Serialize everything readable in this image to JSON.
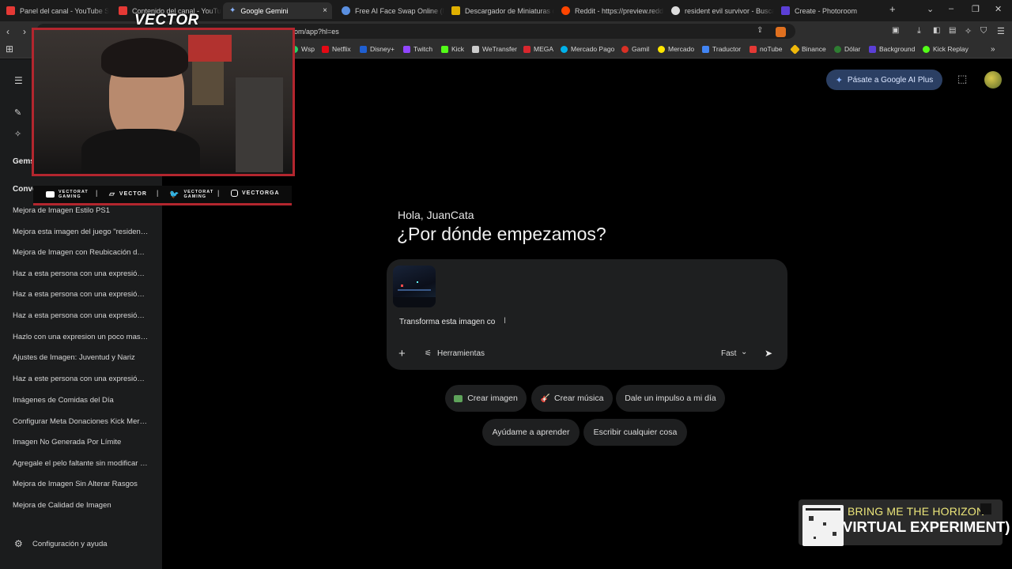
{
  "tabs": [
    {
      "label": "Panel del canal - YouTube Stu",
      "color": "#e53935"
    },
    {
      "label": "Contenido del canal - YouTub",
      "color": "#e53935"
    },
    {
      "label": "Google Gemini",
      "color": "#6fa2ff"
    },
    {
      "label": "Free AI Face Swap Online (No",
      "color": "#5a8fe0"
    },
    {
      "label": "Descargador de Miniaturas de",
      "color": "#e0b000"
    },
    {
      "label": "Reddit - https://preview.redd",
      "color": "#ff4500"
    },
    {
      "label": "resident evil survivor - Buscar",
      "color": "#dddddd"
    },
    {
      "label": "Create - Photoroom",
      "color": "#5b3fd6"
    }
  ],
  "tab_close": "×",
  "new_tab": "+",
  "window_controls": {
    "dropdown": "⌄",
    "minimize": "–",
    "restore": "❐",
    "close": "✕"
  },
  "address": {
    "url": "om/app?hl=es"
  },
  "bookmarks": [
    {
      "label": "Wsp",
      "color": "#25d366"
    },
    {
      "label": "Netflix",
      "color": "#e50914"
    },
    {
      "label": "Disney+",
      "color": "#1f5fd1"
    },
    {
      "label": "Twitch",
      "color": "#9146ff"
    },
    {
      "label": "Kick",
      "color": "#53fc18"
    },
    {
      "label": "WeTransfer",
      "color": "#cccccc"
    },
    {
      "label": "MEGA",
      "color": "#d9272e"
    },
    {
      "label": "Mercado Pago",
      "color": "#00b1ea"
    },
    {
      "label": "Gamil",
      "color": "#d93025"
    },
    {
      "label": "Mercado",
      "color": "#ffe600"
    },
    {
      "label": "Traductor",
      "color": "#4285f4"
    },
    {
      "label": "noTube",
      "color": "#e53935"
    },
    {
      "label": "Binance",
      "color": "#f0b90b"
    },
    {
      "label": "Dólar",
      "color": "#2e7d32"
    },
    {
      "label": "Background",
      "color": "#5b3fd6"
    },
    {
      "label": "Kick Replay",
      "color": "#53fc18"
    }
  ],
  "bookmarks_more": "»",
  "sidebar": {
    "gems_header": "Gems",
    "conversations_header": "Conve",
    "items": [
      "Mejora de Imagen Estilo PS1",
      "Mejora esta imagen del juego \"resident evil survivor\"",
      "Mejora de Imagen con Reubicación de la cámara",
      "Haz a esta persona con una expresión de sorpresa",
      "Haz a esta persona con una expresión de miedo",
      "Haz a esta persona con una expresión de enojo",
      "Hazlo con una expresion un poco mas seria",
      "Ajustes de Imagen: Juventud y Nariz",
      "Haz a este persona con una expresión de alegria",
      "Imágenes de Comidas del Día",
      "Configurar Meta Donaciones Kick Mercado",
      "Imagen No Generada Por Límite",
      "Agregale el pelo faltante sin modificar nada",
      "Mejora de Imagen Sin Alterar Rasgos",
      "Mejora de Calidad de Imagen"
    ],
    "settings": "Configuración y ayuda"
  },
  "main": {
    "upgrade_button": "Pásate a Google AI Plus",
    "greeting": "Hola, JuanCata",
    "headline": "¿Por dónde empezamos?",
    "prompt_text": "Transforma esta imagen co",
    "tools_label": "Herramientas",
    "model_label": "Fast",
    "chips": [
      "Crear imagen",
      "Crear música",
      "Dale un impulso a mi día",
      "Ayúdame a aprender",
      "Escribir cualquier cosa"
    ],
    "chip_icons": [
      "🖼",
      "🎸"
    ]
  },
  "overlay": {
    "brand": "VECTOR",
    "socials": [
      "VECTORAT GAMING",
      "VECTOR",
      "VECTORAT GAMING",
      "VECTORGA"
    ],
    "accent": "#b3262e"
  },
  "music": {
    "artist": "BRING ME THE HORIZON",
    "title": "VIRTUAL EXPERIMENT)"
  },
  "colors": {
    "sidebar": "#1b1c1d",
    "main_bg": "#000000",
    "composer": "#1e1f20",
    "accent_blue": "#2b3f63"
  }
}
